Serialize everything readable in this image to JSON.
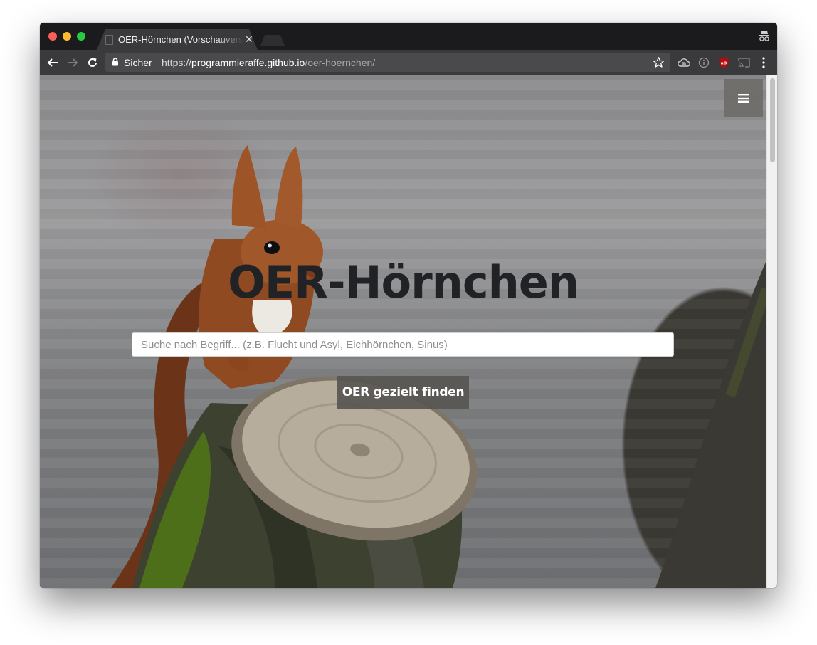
{
  "browser": {
    "tab": {
      "title": "OER-Hörnchen (Vorschauversion)"
    },
    "address_bar": {
      "security_label": "Sicher",
      "url_scheme": "https://",
      "url_host": "programmieraffe.github.io",
      "url_path": "/oer-hoernchen/"
    },
    "icons": {
      "back": "arrow-left-icon",
      "forward": "arrow-right-icon",
      "reload": "reload-icon",
      "lock": "lock-icon",
      "bookmark": "star-icon",
      "extensions": [
        "cloud-extension-icon",
        "info-extension-icon",
        "ublock-extension-icon",
        "cast-icon"
      ],
      "menu": "kebab-menu-icon",
      "incognito": "incognito-icon"
    }
  },
  "page": {
    "title": "OER-Hörnchen",
    "search": {
      "value": "",
      "placeholder": "Suche nach Begriff... (z.B. Flucht und Asyl, Eichhörnchen, Sinus)"
    },
    "submit_label": "OER gezielt finden",
    "menu_icon": "hamburger-menu-icon"
  },
  "colors": {
    "browser_dark": "#1b1b1d",
    "toolbar": "#3a3a3c",
    "title_text": "#212226",
    "button_bg": "#585652"
  }
}
